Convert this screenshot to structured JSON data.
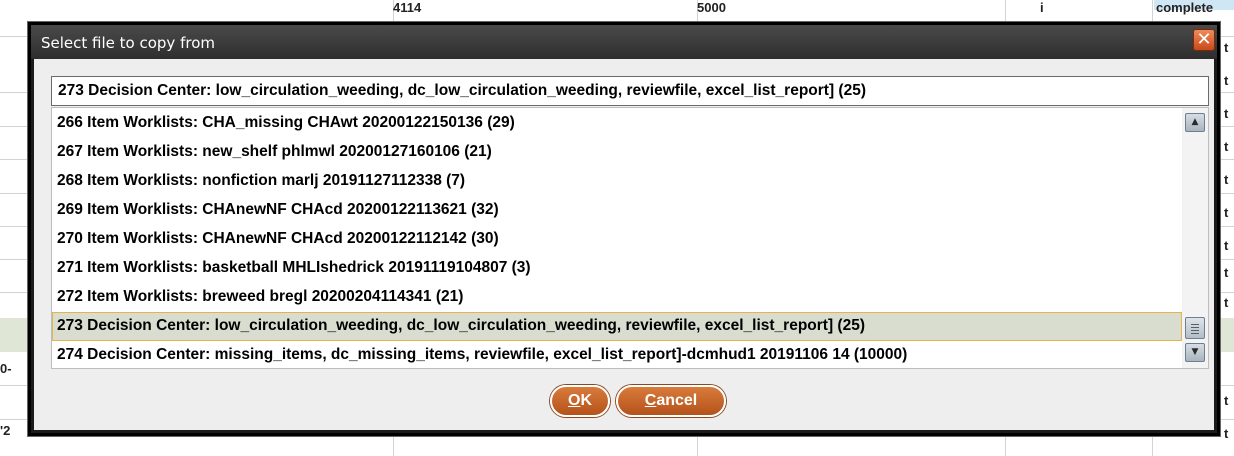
{
  "background": {
    "top_cells": [
      "4114",
      "5000",
      "i",
      "complete"
    ],
    "edge_fragments": [
      "t",
      "t",
      "t",
      "t",
      "t",
      "t",
      "t",
      "t",
      "t",
      "t",
      "t"
    ],
    "left_fragments": [
      "0-",
      "'2"
    ]
  },
  "dialog": {
    "title": "Select file to copy from",
    "close_icon": "close-icon",
    "selected_value": "273  Decision Center: low_circulation_weeding, dc_low_circulation_weeding, reviewfile, excel_list_report] (25)",
    "items": [
      {
        "label": "266  Item Worklists: CHA_missing CHAwt 20200122150136 (29)",
        "selected": false
      },
      {
        "label": "267  Item Worklists: new_shelf phlmwl 20200127160106 (21)",
        "selected": false
      },
      {
        "label": "268  Item Worklists: nonfiction marlj 20191127112338 (7)",
        "selected": false
      },
      {
        "label": "269  Item Worklists: CHAnewNF CHAcd 20200122113621 (32)",
        "selected": false
      },
      {
        "label": "270  Item Worklists: CHAnewNF CHAcd 20200122112142 (30)",
        "selected": false
      },
      {
        "label": "271  Item Worklists: basketball MHLIshedrick 20191119104807 (3)",
        "selected": false
      },
      {
        "label": "272  Item Worklists: breweed bregl 20200204114341 (21)",
        "selected": false
      },
      {
        "label": "273  Decision Center: low_circulation_weeding, dc_low_circulation_weeding, reviewfile, excel_list_report] (25)",
        "selected": true
      },
      {
        "label": "274  Decision Center: missing_items, dc_missing_items, reviewfile, excel_list_report]-dcmhud1 20191106 14 (10000)",
        "selected": false
      }
    ],
    "scroll_up_icon": "arrow-up-icon",
    "scroll_down_icon": "arrow-down-icon",
    "ok_button": {
      "mnemonic": "O",
      "rest": "K"
    },
    "cancel_button": {
      "mnemonic": "C",
      "rest": "ancel"
    },
    "colors": {
      "title_bar": "#3a3a3a",
      "button": "#c4622a",
      "selection_background": "#d8ddd0",
      "selection_border": "#e6b44a"
    }
  }
}
